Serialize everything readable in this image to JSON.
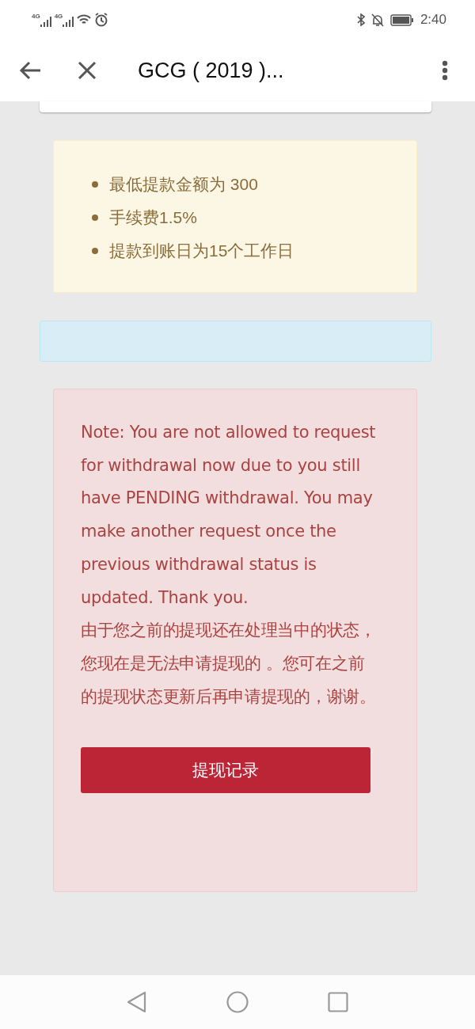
{
  "status_bar": {
    "network_labels": [
      "4G",
      "4G"
    ],
    "time": "2:40"
  },
  "header": {
    "title": "GCG ( 2019 )..."
  },
  "info_box": {
    "items": [
      "最低提款金额为 300",
      "手续费1.5%",
      "提款到账日为15个工作日"
    ]
  },
  "notice_box": {
    "paragraphs": [
      "Note: You are not allowed to request for withdrawal now due to you still have PENDING withdrawal. You may make another request once the previous withdrawal status is updated. Thank you.",
      "由于您之前的提现还在处理当中的状态，您现在是无法申请提现的 。您可在之前的提现状态更新后再申请提现的，谢谢。"
    ],
    "button": "提现记录"
  }
}
